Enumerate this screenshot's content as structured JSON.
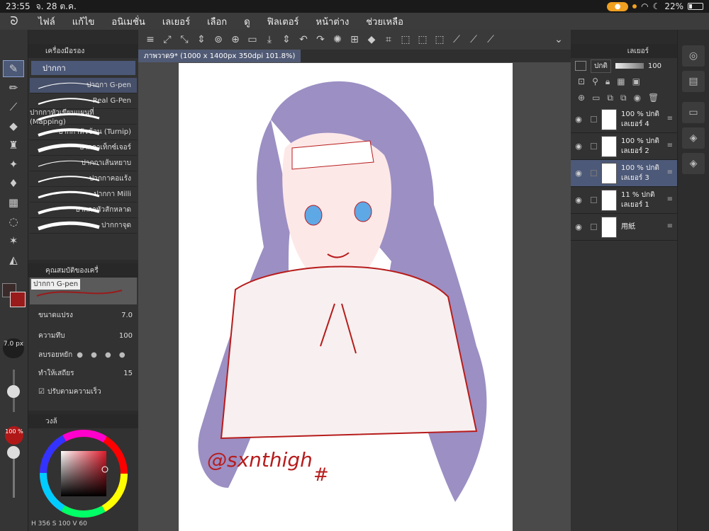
{
  "status": {
    "time": "23:55",
    "date": "จ. 28 ต.ค.",
    "battery": "22%"
  },
  "menu": [
    "ไฟล์",
    "แก้ไข",
    "อนิเมชั่น",
    "เลเยอร์",
    "เลือก",
    "ดู",
    "ฟิลเตอร์",
    "หน้าต่าง",
    "ช่วยเหลือ"
  ],
  "subtool": {
    "panel_title": "เครื่องมือรอง",
    "group": "ปากกา",
    "brushes": [
      "ปากกา G-pen",
      "Real G-Pen",
      "ปากกาหัวเขียนแผนที่ (Mapping)",
      "ปากกาหัวช้อน (Turnip)",
      "ปากกาเท็กซ์เจอร์",
      "ปากกาเส้นหยาบ",
      "ปากกาคอแร้ง",
      "ปากกา Milli",
      "ปากกาหัวสักหลาด",
      "ปากกาจุด"
    ]
  },
  "props": {
    "title": "คุณสมบัติของเครื่",
    "tool": "ปากกา G-pen",
    "size_label": "ขนาดแปรง",
    "size_value": "7.0",
    "opacity_label": "ความทึบ",
    "opacity_value": "100",
    "aa_label": "ลบรอยหยัก",
    "stab_label": "ทำให้เสถียร",
    "stab_value": "15",
    "speed_label": "ปรับตามความเร็ว"
  },
  "brush_size_readout": "7.0 px",
  "opacity_readout": "100 %",
  "color": {
    "title": "วงล้",
    "h": "356",
    "s": "100",
    "v": "60",
    "fg": "#991b1b",
    "bg": "#3a2a2a"
  },
  "document": {
    "tab": "ภาพวาด9* (1000 x 1400px 350dpi 101.8%)"
  },
  "layers": {
    "title": "เลเยอร์",
    "blend": "ปกติ",
    "opacity": "100",
    "items": [
      {
        "pct": "100 %",
        "mode": "ปกติ",
        "name": "เลเยอร์ 4"
      },
      {
        "pct": "100 %",
        "mode": "ปกติ",
        "name": "เลเยอร์ 2"
      },
      {
        "pct": "100 %",
        "mode": "ปกติ",
        "name": "เลเยอร์ 3"
      },
      {
        "pct": "11 %",
        "mode": "ปกติ",
        "name": "เลเยอร์ 1"
      },
      {
        "pct": "",
        "mode": "",
        "name": "用紙"
      }
    ]
  },
  "signature": "@sxnthigh"
}
